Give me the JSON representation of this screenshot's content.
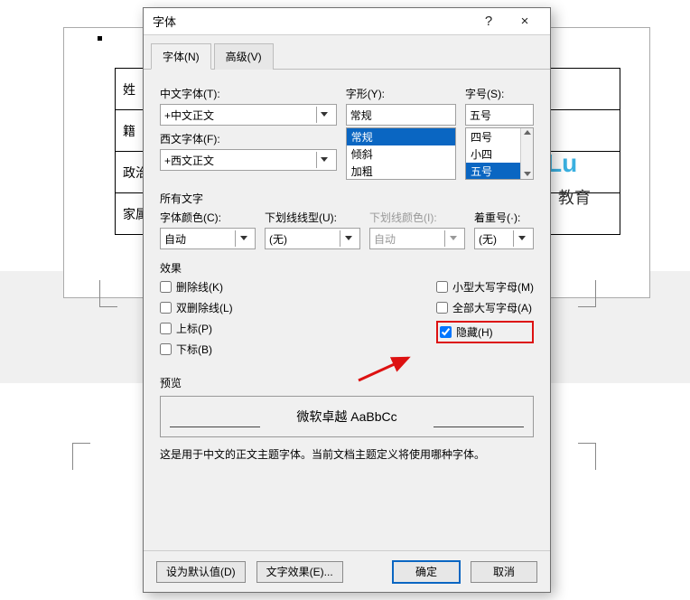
{
  "bg_table": {
    "r1": "姓",
    "r2": "籍",
    "r3": "政治",
    "r4": "家属"
  },
  "watermark1": "Lu",
  "watermark2": "教育",
  "dialog": {
    "title": "字体",
    "help": "?",
    "close": "×",
    "tabs": {
      "font": "字体(N)",
      "advanced": "高级(V)"
    },
    "labels": {
      "cjk_font": "中文字体(T):",
      "latin_font": "西文字体(F):",
      "style": "字形(Y):",
      "size": "字号(S):",
      "all_text": "所有文字",
      "font_color": "字体颜色(C):",
      "underline_style": "下划线线型(U):",
      "underline_color": "下划线颜色(I):",
      "emphasis": "着重号(·):",
      "effects": "效果",
      "preview": "预览"
    },
    "values": {
      "cjk_font": "+中文正文",
      "latin_font": "+西文正文",
      "style": "常规",
      "size": "五号",
      "styles_list": [
        "常规",
        "倾斜",
        "加粗"
      ],
      "sizes_list": [
        "四号",
        "小四",
        "五号"
      ],
      "color": "自动",
      "underline_style": "(无)",
      "underline_color": "自动",
      "emphasis": "(无)"
    },
    "effects": {
      "left": [
        {
          "key": "删除线(K)",
          "checked": false
        },
        {
          "key": "双删除线(L)",
          "checked": false
        },
        {
          "key": "上标(P)",
          "checked": false
        },
        {
          "key": "下标(B)",
          "checked": false
        }
      ],
      "right": [
        {
          "key": "小型大写字母(M)",
          "checked": false
        },
        {
          "key": "全部大写字母(A)",
          "checked": false
        },
        {
          "key": "隐藏(H)",
          "checked": true
        }
      ]
    },
    "preview_text": "微软卓越  AaBbCc",
    "hint": "这是用于中文的正文主题字体。当前文档主题定义将使用哪种字体。",
    "buttons": {
      "set_default": "设为默认值(D)",
      "text_effects": "文字效果(E)...",
      "ok": "确定",
      "cancel": "取消"
    }
  }
}
